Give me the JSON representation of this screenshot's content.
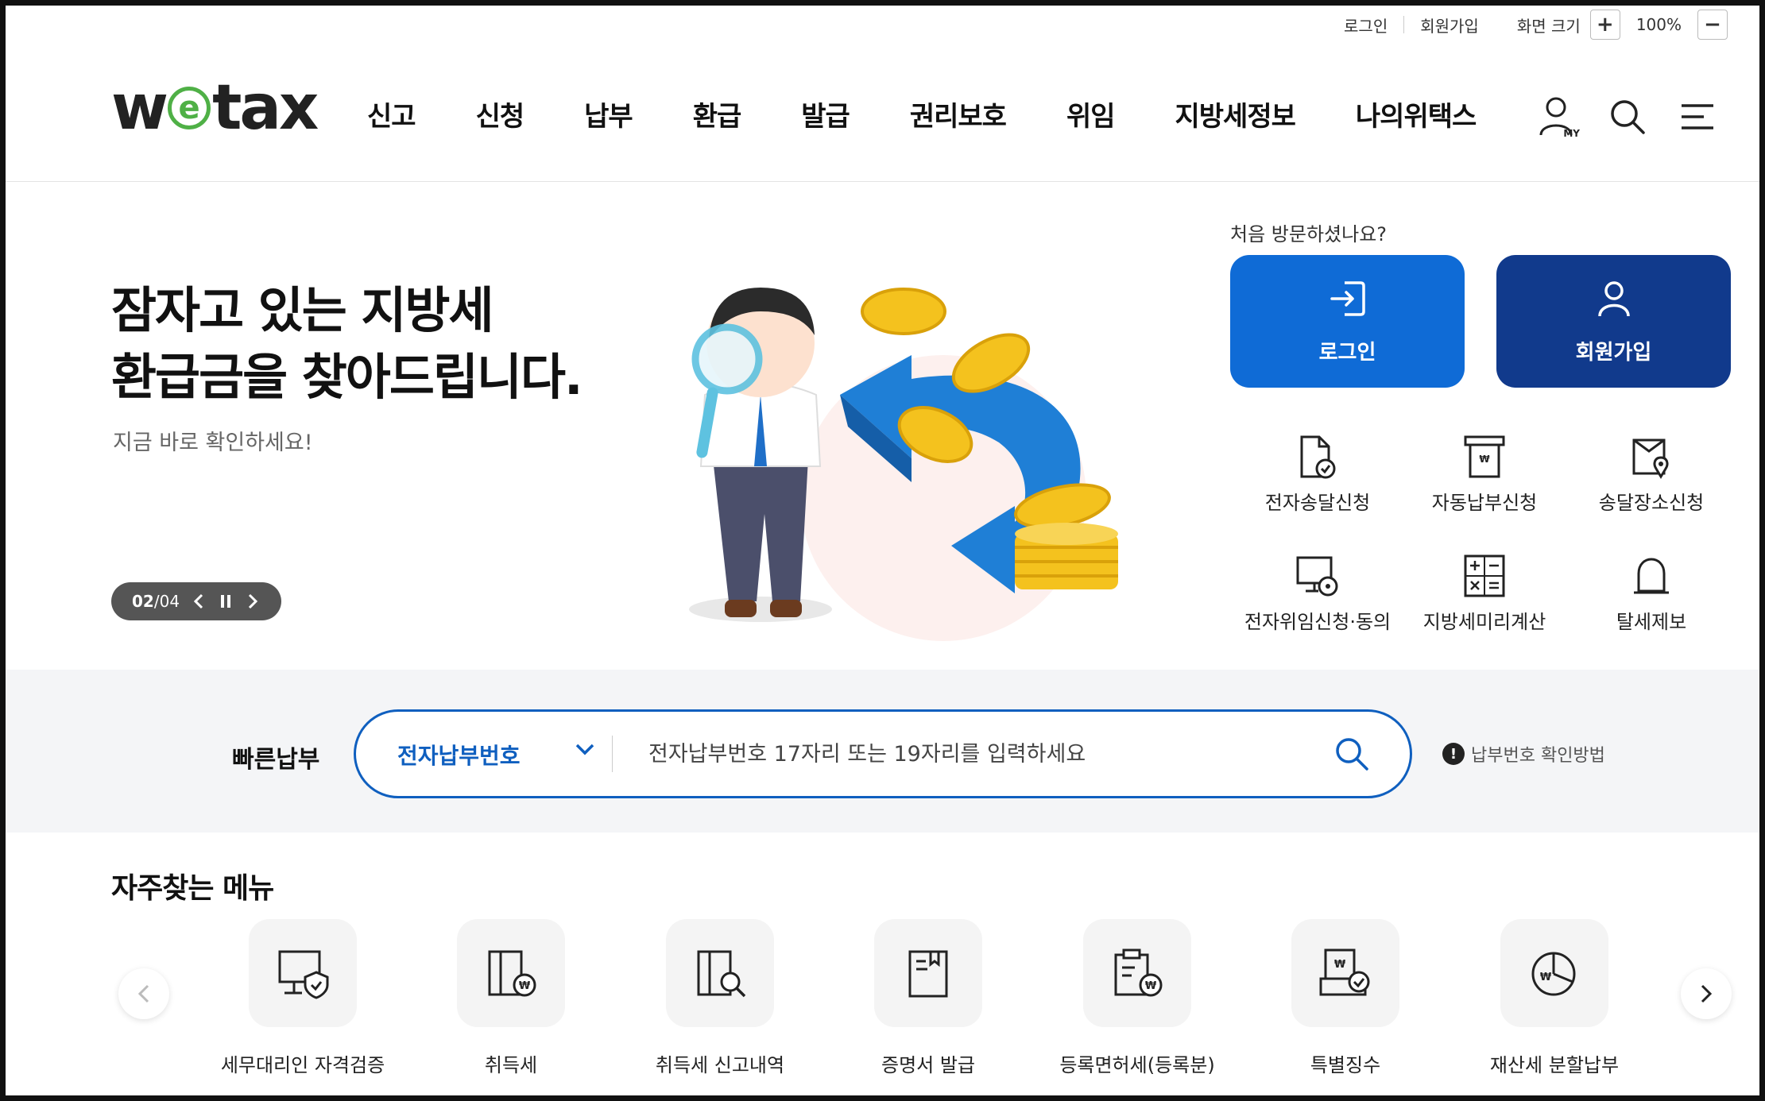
{
  "utility": {
    "login": "로그인",
    "signup": "회원가입",
    "zoom_label": "화면 크기",
    "zoom_plus": "+",
    "zoom_value": "100%",
    "zoom_minus": "−"
  },
  "header": {
    "logo_w": "w",
    "logo_e": "e",
    "logo_tax": "tax",
    "nav": [
      "신고",
      "신청",
      "납부",
      "환급",
      "발급",
      "권리보호",
      "위임",
      "지방세정보",
      "나의위택스"
    ],
    "my_badge": "MY",
    "icons": [
      "my-page-icon",
      "search-icon",
      "menu-icon"
    ]
  },
  "hero": {
    "title_line1": "잠자고 있는 지방세",
    "title_line2": "환급금을 찾아드립니다.",
    "subtitle": "지금 바로 확인하세요!",
    "pager_current": "02",
    "pager_sep": " / ",
    "pager_total": "04"
  },
  "side": {
    "first_visit": "처음 방문하셨나요?",
    "login_label": "로그인",
    "join_label": "회원가입",
    "quick": [
      "전자송달신청",
      "자동납부신청",
      "송달장소신청",
      "전자위임신청·동의",
      "지방세미리계산",
      "탈세제보"
    ]
  },
  "quickpay": {
    "label": "빠른납부",
    "select_value": "전자납부번호",
    "placeholder": "전자납부번호 17자리 또는 19자리를 입력하세요",
    "help_mark": "!",
    "help_text": "납부번호 확인방법"
  },
  "frequent": {
    "title": "자주찾는 메뉴",
    "items": [
      "세무대리인 자격검증",
      "취득세",
      "취득세 신고내역",
      "증명서 발급",
      "등록면허세(등록분)",
      "특별징수",
      "재산세 분할납부"
    ]
  },
  "colors": {
    "primary_blue": "#0f6bd6",
    "navy": "#113a8c",
    "logo_green": "#4fb046",
    "band_bg": "#f4f5f7"
  }
}
